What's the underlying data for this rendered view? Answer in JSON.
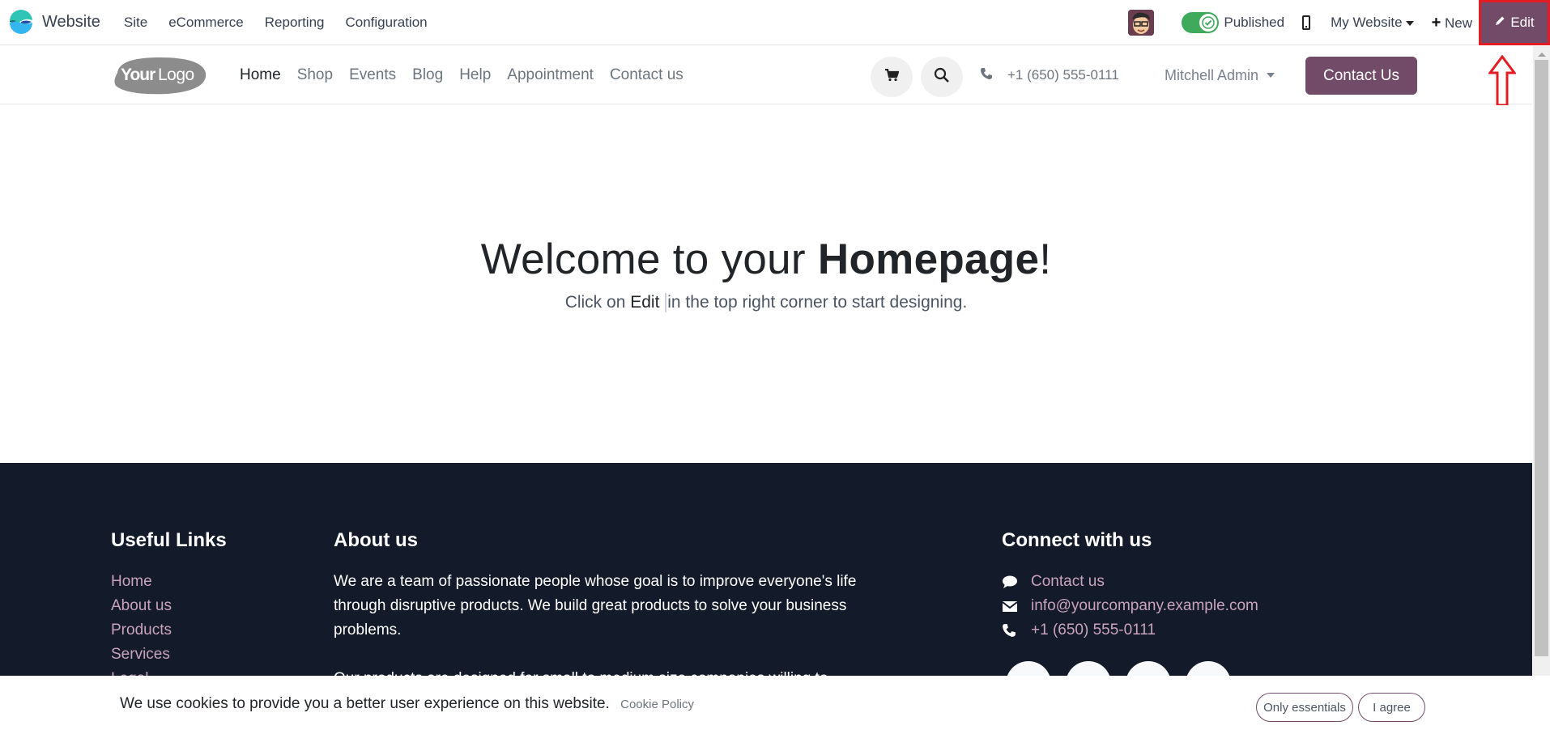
{
  "topbar": {
    "app_name": "Website",
    "menu": [
      "Site",
      "eCommerce",
      "Reporting",
      "Configuration"
    ],
    "published_label": "Published",
    "published": true,
    "website_selector": "My Website",
    "new_label": "New",
    "edit_label": "Edit"
  },
  "header": {
    "logo_text": "YourLogo",
    "nav": [
      {
        "label": "Home",
        "active": true
      },
      {
        "label": "Shop"
      },
      {
        "label": "Events"
      },
      {
        "label": "Blog"
      },
      {
        "label": "Help"
      },
      {
        "label": "Appointment"
      },
      {
        "label": "Contact us"
      }
    ],
    "phone": "+1 (650) 555-0111",
    "user": "Mitchell Admin",
    "contact_button": "Contact Us"
  },
  "hero": {
    "title_normal": "Welcome to your ",
    "title_bold": "Homepage",
    "title_end": "!",
    "subtitle_pre": "Click on ",
    "subtitle_bold": "Edit",
    "subtitle_post": "in the top right corner to start designing."
  },
  "footer": {
    "useful_links_title": "Useful Links",
    "useful_links": [
      "Home",
      "About us",
      "Products",
      "Services",
      "Legal"
    ],
    "about_title": "About us",
    "about_paragraphs": [
      "We are a team of passionate people whose goal is to improve everyone's life through disruptive products. We build great products to solve your business problems.",
      "Our products are designed for small to medium size companies willing to optimize their performance."
    ],
    "connect_title": "Connect with us",
    "connect": [
      {
        "icon": "comment-icon",
        "label": "Contact us"
      },
      {
        "icon": "envelope-icon",
        "label": "info@yourcompany.example.com"
      },
      {
        "icon": "phone-icon",
        "label": "+1 (650) 555-0111"
      }
    ]
  },
  "cookie": {
    "message": "We use cookies to provide you a better user experience on this website.",
    "policy_link": "Cookie Policy",
    "only_essentials": "Only essentials",
    "agree": "I agree"
  },
  "colors": {
    "brand": "#714b67",
    "footer_bg": "#131a29",
    "link_pink": "#c9a3bd",
    "toggle_green": "#3fa95c",
    "annotation_red": "#e31c24"
  }
}
